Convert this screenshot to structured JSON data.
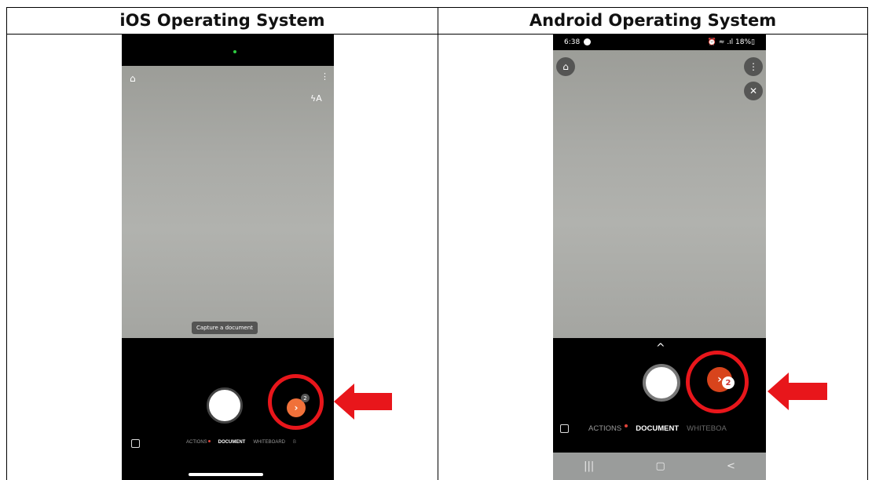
{
  "header": {
    "left": "iOS Operating System",
    "right": "Android Operating System"
  },
  "ios": {
    "hint": "Capture a document",
    "next_count": "2",
    "next_icon": "chevron-right-icon",
    "home_icon": "home-icon",
    "menu_icon": "more-vert-icon",
    "flash_icon": "flash-auto-icon",
    "modes": [
      "ACTIONS",
      "DOCUMENT",
      "WHITEBOARD",
      "B"
    ],
    "active_mode": "DOCUMENT"
  },
  "android": {
    "status": {
      "time": "6:38",
      "right": "⏰ ≈ .ıl 18%▯"
    },
    "next_count": "2",
    "modes": [
      "ACTIONS",
      "DOCUMENT",
      "WHITEBOA"
    ],
    "active_mode": "DOCUMENT",
    "nav": [
      "|||",
      "▢",
      "<"
    ]
  },
  "colors": {
    "highlight": "#e8161b",
    "ios_next": "#f0713a",
    "android_next": "#d8441c",
    "camera_gray": "#abaca8"
  }
}
